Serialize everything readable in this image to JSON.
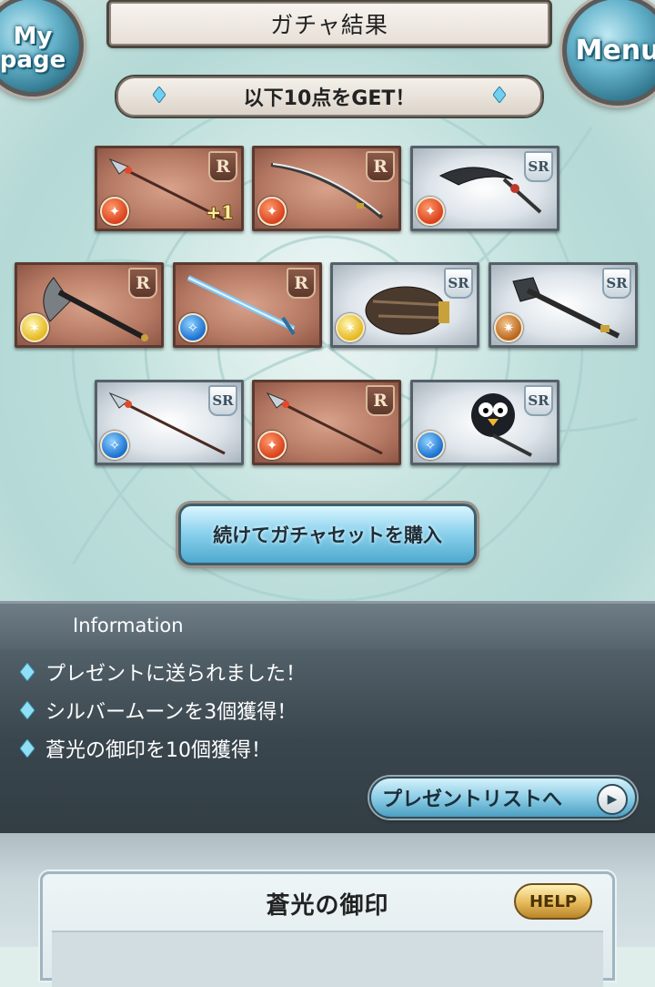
{
  "header": {
    "title": "ガチャ結果",
    "mypage_label": "My page",
    "menu_label": "Menu"
  },
  "banner": {
    "text": "以下10点をGET！"
  },
  "cards": [
    {
      "rarity": "R",
      "element": "fire",
      "weapon": "spear",
      "bonus": "+1"
    },
    {
      "rarity": "R",
      "element": "fire",
      "weapon": "katana",
      "bonus": ""
    },
    {
      "rarity": "SR",
      "element": "fire",
      "weapon": "scimitar",
      "bonus": ""
    },
    {
      "rarity": "R",
      "element": "light",
      "weapon": "axe",
      "bonus": ""
    },
    {
      "rarity": "R",
      "element": "water",
      "weapon": "sword",
      "bonus": ""
    },
    {
      "rarity": "SR",
      "element": "light",
      "weapon": "gauntlet",
      "bonus": ""
    },
    {
      "rarity": "SR",
      "element": "earth",
      "weapon": "mace",
      "bonus": ""
    },
    {
      "rarity": "SR",
      "element": "water",
      "weapon": "spear",
      "bonus": ""
    },
    {
      "rarity": "R",
      "element": "fire",
      "weapon": "spear",
      "bonus": ""
    },
    {
      "rarity": "SR",
      "element": "water",
      "weapon": "penguin-staff",
      "bonus": ""
    }
  ],
  "continue_button": {
    "label": "続けてガチャセットを購入"
  },
  "info": {
    "title": "Information",
    "items": [
      "プレゼントに送られました！",
      "シルバームーンを3個獲得！",
      "蒼光の御印を10個獲得！"
    ],
    "present_button_label": "プレゼントリストへ"
  },
  "item_panel": {
    "title": "蒼光の御印",
    "help_label": "HELP"
  },
  "colors": {
    "accent": "#65b3cb",
    "panel": "#3a464e",
    "r_card": "#b67a64",
    "sr_card": "#dde4ea"
  }
}
